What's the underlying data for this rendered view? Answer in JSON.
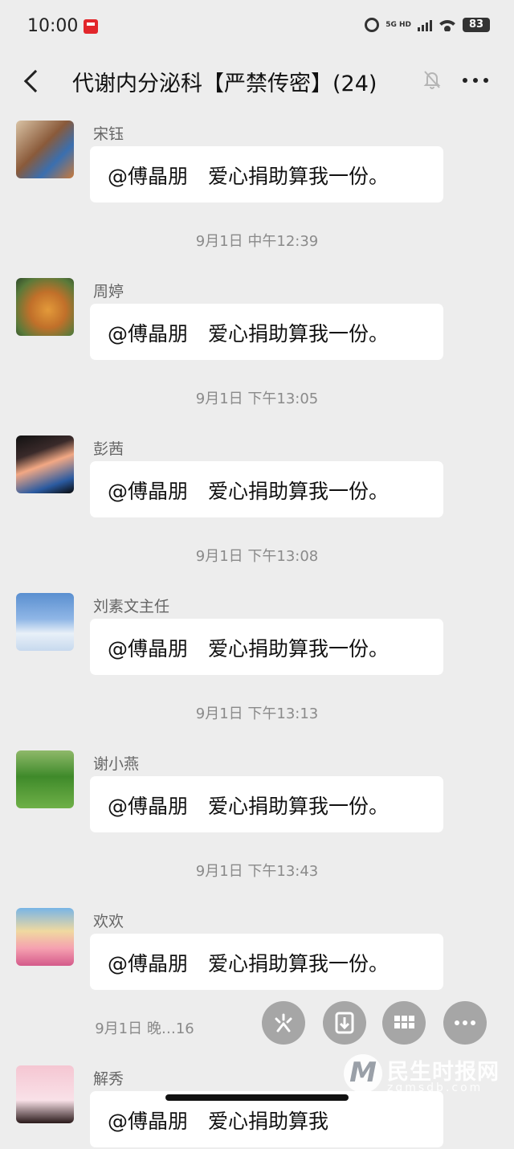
{
  "status": {
    "time": "10:00",
    "network": "5G HD",
    "battery": "83"
  },
  "header": {
    "title": "代谢内分泌科【严禁传密】(24)"
  },
  "messages": [
    {
      "sender": "宋钰",
      "text": "@傅晶朋　爱心捐助算我一份。",
      "timestamp": "9月1日 中午12:39"
    },
    {
      "sender": "周婷",
      "text": "@傅晶朋　爱心捐助算我一份。",
      "timestamp": "9月1日 下午13:05"
    },
    {
      "sender": "彭茜",
      "text": "@傅晶朋　爱心捐助算我一份。",
      "timestamp": "9月1日 下午13:08"
    },
    {
      "sender": "刘素文主任",
      "text": "@傅晶朋　爱心捐助算我一份。",
      "timestamp": "9月1日 下午13:13"
    },
    {
      "sender": "谢小燕",
      "text": "@傅晶朋　爱心捐助算我一份。",
      "timestamp": "9月1日 下午13:43"
    },
    {
      "sender": "欢欢",
      "text": "@傅晶朋　爱心捐助算我一份。",
      "timestamp": "9月1日 晚…16"
    },
    {
      "sender": "解秀",
      "text": "@傅晶朋　爱心捐助算我",
      "timestamp": ""
    }
  ],
  "watermark": {
    "text": "民生时报网",
    "sub": "zgmsdb.com"
  },
  "icons": {
    "back": "back-arrow-icon",
    "mute": "bell-muted-icon",
    "more": "more-dots-icon"
  }
}
